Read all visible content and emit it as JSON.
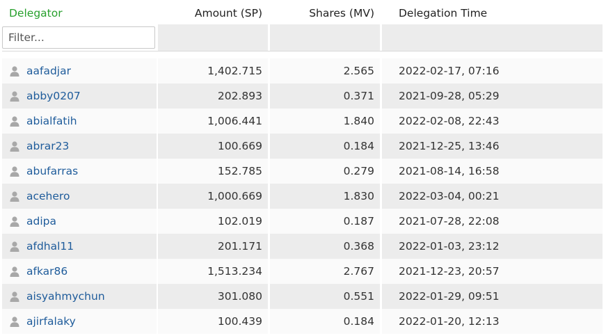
{
  "table": {
    "headers": {
      "delegator": "Delegator",
      "amount": "Amount (SP)",
      "shares": "Shares (MV)",
      "time": "Delegation Time"
    },
    "filter_placeholder": "Filter...",
    "rows": [
      {
        "name": "aafadjar",
        "amount": "1,402.715",
        "shares": "2.565",
        "time": "2022-02-17, 07:16"
      },
      {
        "name": "abby0207",
        "amount": "202.893",
        "shares": "0.371",
        "time": "2021-09-28, 05:29"
      },
      {
        "name": "abialfatih",
        "amount": "1,006.441",
        "shares": "1.840",
        "time": "2022-02-08, 22:43"
      },
      {
        "name": "abrar23",
        "amount": "100.669",
        "shares": "0.184",
        "time": "2021-12-25, 13:46"
      },
      {
        "name": "abufarras",
        "amount": "152.785",
        "shares": "0.279",
        "time": "2021-08-14, 16:58"
      },
      {
        "name": "acehero",
        "amount": "1,000.669",
        "shares": "1.830",
        "time": "2022-03-04, 00:21"
      },
      {
        "name": "adipa",
        "amount": "102.019",
        "shares": "0.187",
        "time": "2021-07-28, 22:08"
      },
      {
        "name": "afdhal11",
        "amount": "201.171",
        "shares": "0.368",
        "time": "2022-01-03, 23:12"
      },
      {
        "name": "afkar86",
        "amount": "1,513.234",
        "shares": "2.767",
        "time": "2021-12-23, 20:57"
      },
      {
        "name": "aisyahmychun",
        "amount": "301.080",
        "shares": "0.551",
        "time": "2022-01-29, 09:51"
      },
      {
        "name": "ajirfalaky",
        "amount": "100.439",
        "shares": "0.184",
        "time": "2022-01-20, 12:13"
      }
    ]
  },
  "colors": {
    "header_delegator": "#28a02d",
    "link": "#1f5c9b",
    "row_alt": "#ececec",
    "row_light": "#fafafa"
  },
  "icons": {
    "avatar": "user-silhouette-icon"
  }
}
